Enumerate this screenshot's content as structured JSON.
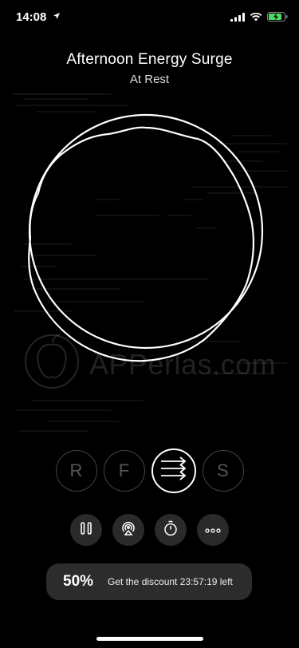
{
  "status": {
    "time": "14:08"
  },
  "session": {
    "title": "Afternoon Energy Surge",
    "state": "At Rest"
  },
  "watermark": "APPerlas.com",
  "modes": [
    {
      "label": "R",
      "active": false
    },
    {
      "label": "F",
      "active": false
    },
    {
      "label": "",
      "active": true,
      "icon": "flow-arrows-icon"
    },
    {
      "label": "S",
      "active": false
    }
  ],
  "controls": [
    "pause-icon",
    "airplay-icon",
    "timer-icon",
    "more-icon"
  ],
  "promo": {
    "percent": "50%",
    "text": "Get the discount 23:57:19 left"
  },
  "colors": {
    "background": "#000000",
    "accent": "#ffffff",
    "inactive": "#444444"
  }
}
